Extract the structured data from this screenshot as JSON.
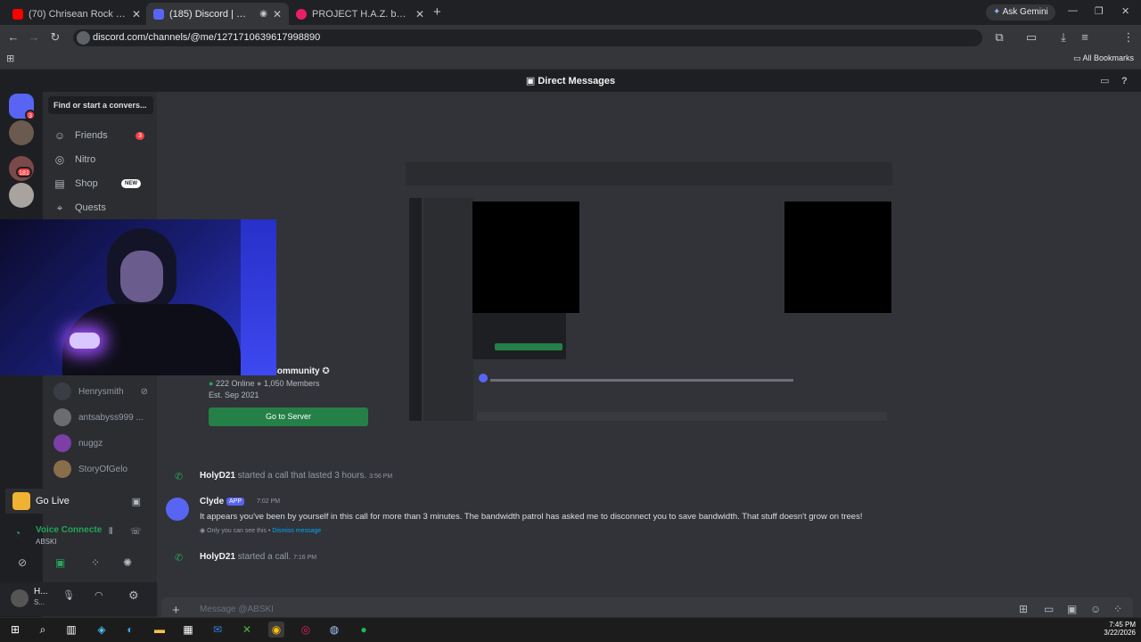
{
  "browser": {
    "tabs": [
      {
        "title": "(70) Chrisean Rock is trying to g",
        "fav": "#ff0000"
      },
      {
        "title": "(185) Discord | @ABSKI",
        "fav": "#5865f2"
      },
      {
        "title": "PROJECT H.A.Z. by Holy | Bandi",
        "fav": "#e91e63"
      }
    ],
    "ask_gemini": "Ask Gemini",
    "url": "discord.com/channels/@me/1271710639617998890",
    "all_bookmarks": "All Bookmarks"
  },
  "discord": {
    "header_title": "Direct Messages",
    "search_placeholder": "Find or start a convers...",
    "nav": [
      {
        "label": "Friends",
        "badge": "3",
        "icon": "friends-icon"
      },
      {
        "label": "Nitro",
        "icon": "nitro-icon"
      },
      {
        "label": "Shop",
        "tag": "NEW",
        "icon": "shop-icon"
      },
      {
        "label": "Quests",
        "icon": "quests-icon"
      }
    ],
    "guild_badges": [
      "3",
      "181"
    ],
    "dms": [
      {
        "name": "Henrysmith",
        "color": "#3b3d44"
      },
      {
        "name": "antsabyss999 ...",
        "color": "#6a6c70"
      },
      {
        "name": "nuggz",
        "color": "#7b3fa6"
      },
      {
        "name": "StoryOfGelo",
        "color": "#8a6d4a"
      }
    ],
    "go_live": "Go Live",
    "voice_status": "Voice Connecte",
    "voice_channel": "ABSKI",
    "user_short": "H...",
    "user_status": "S...",
    "server_card": {
      "name": "Deon owens's Community",
      "online": "222 Online",
      "members": "1,050 Members",
      "est": "Est. Sep 2021",
      "button": "Go to Server"
    },
    "messages": [
      {
        "author": "HolyD21",
        "text": "started a call that lasted 3 hours.",
        "time": "3:56 PM"
      },
      {
        "author": "Clyde",
        "tag": "APP",
        "time": "7:02 PM",
        "text": "It appears you've been by yourself in this call for more than 3 minutes. The bandwidth patrol has asked me to disconnect you to save bandwidth. That stuff doesn't grow on trees!",
        "note": "Only you can see this •",
        "dismiss": "Dismiss message"
      },
      {
        "author": "HolyD21",
        "text": "started a call.",
        "time": "7:16 PM"
      }
    ],
    "input_placeholder": "Message @ABSKI"
  },
  "taskbar": {
    "time": "7:45 PM",
    "date": "3/22/2026"
  }
}
